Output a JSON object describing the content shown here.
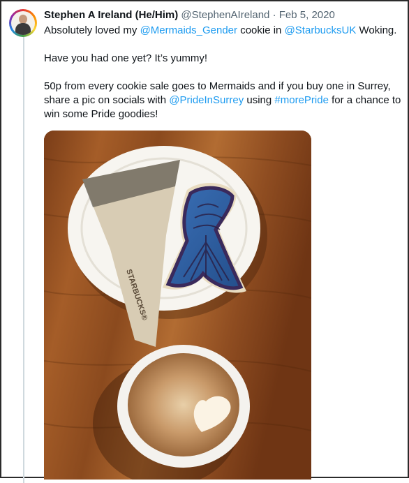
{
  "tweet": {
    "display_name": "Stephen A Ireland (He/Him)",
    "handle": "@StephenAIreland",
    "separator": " · ",
    "date": "Feb 5, 2020",
    "line1": {
      "t1": "Absolutely loved my ",
      "mention_mermaids": "@Mermaids_Gender",
      "t2": " cookie in ",
      "mention_starbucks": "@StarbucksUK",
      "t3": " Woking."
    },
    "line2": "Have you had one yet? It’s yummy!",
    "line3": {
      "t1": "50p from every cookie sale goes to Mermaids and if you buy one in Surrey, share a pic on socials with ",
      "mention_pride": "@PrideInSurrey",
      "t2": " using ",
      "hashtag": "#morePride",
      "t3": " for a chance to win some Pride goodies!"
    },
    "media": {
      "napkin_text": "STARBUCKS®",
      "colors": {
        "table": "#9a5626",
        "saucer": "#f7f5f0",
        "napkin": "#d8ccb4",
        "cookie_icing": "#2f5d9e",
        "cookie_outline": "#3a2a5c",
        "latte": "#c99a6a",
        "link_blue": "#1d9bf0"
      }
    }
  }
}
